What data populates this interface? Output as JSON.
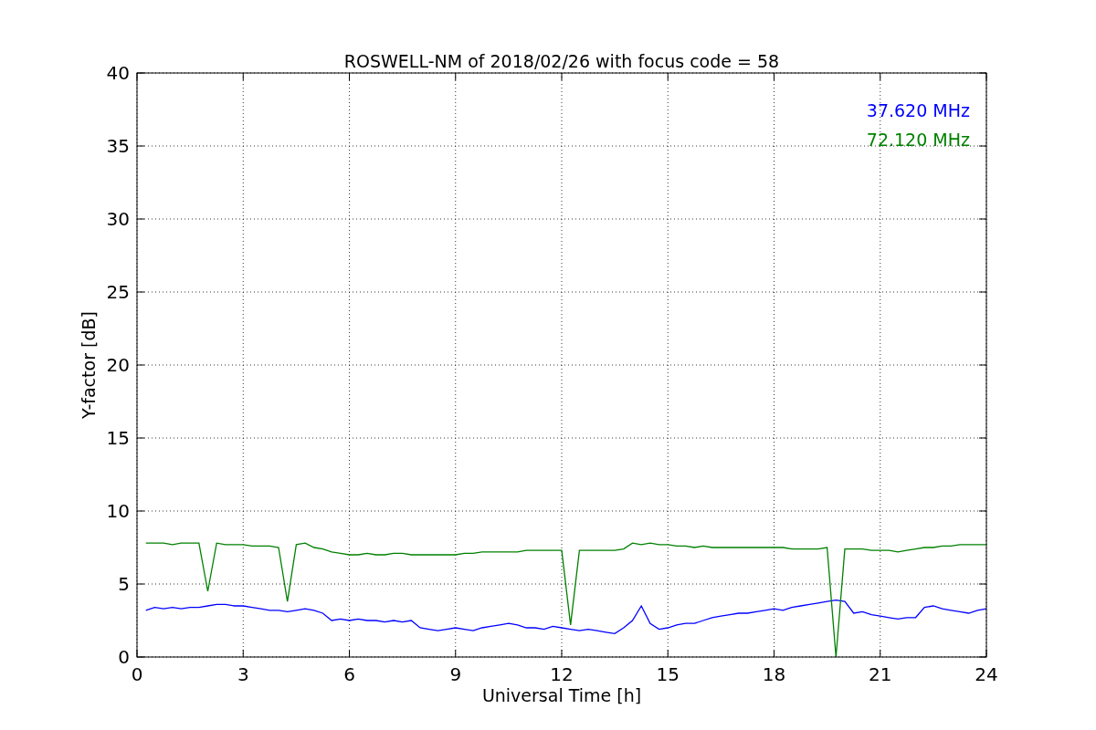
{
  "figure": {
    "chart_data": {
      "type": "line",
      "title": "ROSWELL-NM of 2018/02/26 with focus code = 58",
      "xlabel": "Universal Time [h]",
      "ylabel": "Y-factor [dB]",
      "x": [
        0.25,
        0.5,
        0.75,
        1,
        1.25,
        1.5,
        1.75,
        2,
        2.25,
        2.5,
        2.75,
        3,
        3.25,
        3.5,
        3.75,
        4,
        4.25,
        4.5,
        4.75,
        5,
        5.25,
        5.5,
        5.75,
        6,
        6.25,
        6.5,
        6.75,
        7,
        7.25,
        7.5,
        7.75,
        8,
        8.25,
        8.5,
        8.75,
        9,
        9.25,
        9.5,
        9.75,
        10,
        10.25,
        10.5,
        10.75,
        11,
        11.25,
        11.5,
        11.75,
        12,
        12.25,
        12.5,
        12.75,
        13,
        13.25,
        13.5,
        13.75,
        14,
        14.25,
        14.5,
        14.75,
        15,
        15.25,
        15.5,
        15.75,
        16,
        16.25,
        16.5,
        16.75,
        17,
        17.25,
        17.5,
        17.75,
        18,
        18.25,
        18.5,
        18.75,
        19,
        19.25,
        19.5,
        19.75,
        20,
        20.25,
        20.5,
        20.75,
        21,
        21.25,
        21.5,
        21.75,
        22,
        22.25,
        22.5,
        22.75,
        23,
        23.25,
        23.5,
        23.75,
        24
      ],
      "series": [
        {
          "name": "37.620 MHz",
          "color": "#0000ff",
          "values": [
            3.2,
            3.4,
            3.3,
            3.4,
            3.3,
            3.4,
            3.4,
            3.5,
            3.6,
            3.6,
            3.5,
            3.5,
            3.4,
            3.3,
            3.2,
            3.2,
            3.1,
            3.2,
            3.3,
            3.2,
            3.0,
            2.5,
            2.6,
            2.5,
            2.6,
            2.5,
            2.5,
            2.4,
            2.5,
            2.4,
            2.5,
            2.0,
            1.9,
            1.8,
            1.9,
            2.0,
            1.9,
            1.8,
            2.0,
            2.1,
            2.2,
            2.3,
            2.2,
            2.0,
            2.0,
            1.9,
            2.1,
            2.0,
            1.9,
            1.8,
            1.9,
            1.8,
            1.7,
            1.6,
            2.0,
            2.5,
            3.5,
            2.3,
            1.9,
            2.0,
            2.2,
            2.3,
            2.3,
            2.5,
            2.7,
            2.8,
            2.9,
            3.0,
            3.0,
            3.1,
            3.2,
            3.3,
            3.2,
            3.4,
            3.5,
            3.6,
            3.7,
            3.8,
            3.9,
            3.8,
            3.0,
            3.1,
            2.9,
            2.8,
            2.7,
            2.6,
            2.7,
            2.7,
            3.4,
            3.5,
            3.3,
            3.2,
            3.1,
            3.0,
            3.2,
            3.3
          ]
        },
        {
          "name": "72.120 MHz",
          "color": "#008000",
          "values": [
            7.8,
            7.8,
            7.8,
            7.7,
            7.8,
            7.8,
            7.8,
            4.5,
            7.8,
            7.7,
            7.7,
            7.7,
            7.6,
            7.6,
            7.6,
            7.5,
            3.8,
            7.7,
            7.8,
            7.5,
            7.4,
            7.2,
            7.1,
            7.0,
            7.0,
            7.1,
            7.0,
            7.0,
            7.1,
            7.1,
            7.0,
            7.0,
            7.0,
            7.0,
            7.0,
            7.0,
            7.1,
            7.1,
            7.2,
            7.2,
            7.2,
            7.2,
            7.2,
            7.3,
            7.3,
            7.3,
            7.3,
            7.3,
            2.2,
            7.3,
            7.3,
            7.3,
            7.3,
            7.3,
            7.4,
            7.8,
            7.7,
            7.8,
            7.7,
            7.7,
            7.6,
            7.6,
            7.5,
            7.6,
            7.5,
            7.5,
            7.5,
            7.5,
            7.5,
            7.5,
            7.5,
            7.5,
            7.5,
            7.4,
            7.4,
            7.4,
            7.4,
            7.5,
            0.0,
            7.4,
            7.4,
            7.4,
            7.3,
            7.3,
            7.3,
            7.2,
            7.3,
            7.4,
            7.5,
            7.5,
            7.6,
            7.6,
            7.7,
            7.7,
            7.7,
            7.7
          ]
        }
      ],
      "grid": true,
      "xlim": [
        0,
        24
      ],
      "ylim": [
        0,
        40
      ],
      "xticks": [
        0,
        3,
        6,
        9,
        12,
        15,
        18,
        21,
        24
      ],
      "yticks": [
        0,
        5,
        10,
        15,
        20,
        25,
        30,
        35,
        40
      ]
    }
  }
}
